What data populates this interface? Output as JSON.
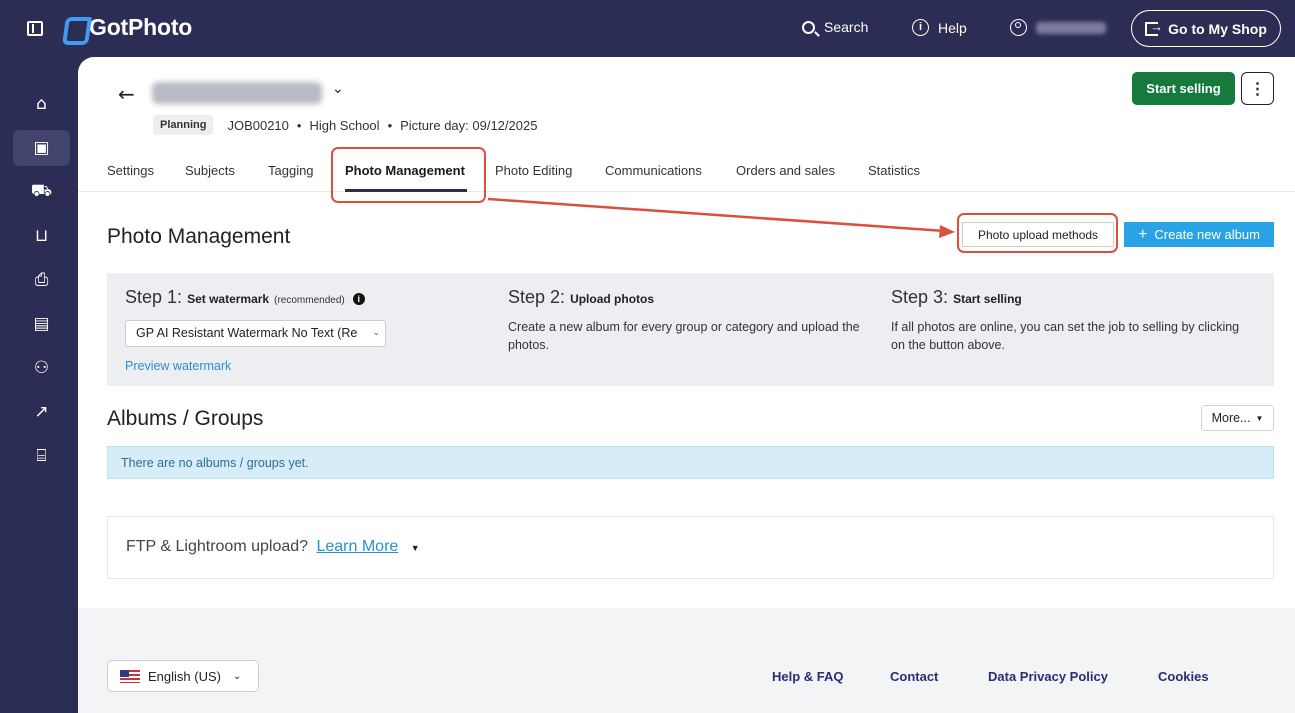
{
  "app": {
    "brand": "GotPhoto",
    "top_nav": {
      "search_label": "Search",
      "help_label": "Help",
      "shop_button": "Go to My Shop"
    },
    "sidebar": [
      {
        "icon": "home-icon",
        "glyph": "⌂"
      },
      {
        "icon": "photo-icon",
        "glyph": "▣",
        "active": true
      },
      {
        "icon": "cart-icon",
        "glyph": "🛒"
      },
      {
        "icon": "basket-icon",
        "glyph": "⊔"
      },
      {
        "icon": "printer-icon",
        "glyph": "⎙"
      },
      {
        "icon": "message-icon",
        "glyph": "▤"
      },
      {
        "icon": "user-icon",
        "glyph": "⚇"
      },
      {
        "icon": "analytics-icon",
        "glyph": "📈"
      },
      {
        "icon": "store-icon",
        "glyph": "⌸"
      }
    ]
  },
  "job": {
    "status_badge": "Planning",
    "job_id": "JOB00210",
    "school_type": "High School",
    "picture_day": "Picture day: 09/12/2025",
    "start_selling": "Start selling",
    "more_actions": "⋮"
  },
  "tabs": [
    {
      "label": "Settings"
    },
    {
      "label": "Subjects"
    },
    {
      "label": "Tagging"
    },
    {
      "label": "Photo Management",
      "active": true
    },
    {
      "label": "Photo Editing"
    },
    {
      "label": "Communications"
    },
    {
      "label": "Orders and sales"
    },
    {
      "label": "Statistics"
    }
  ],
  "photo_management": {
    "title": "Photo Management",
    "upload_methods_button": "Photo upload methods",
    "create_album_button": "Create new album",
    "steps": [
      {
        "prefix": "Step 1:",
        "name": "Set watermark",
        "note": "(recommended)"
      },
      {
        "prefix": "Step 2:",
        "name": "Upload photos",
        "description": "Create a new album for every group or category and upload the photos."
      },
      {
        "prefix": "Step 3:",
        "name": "Start selling",
        "description": "If all photos are online, you can set the job to selling by clicking on the button above."
      }
    ],
    "watermark_select_value": "GP AI Resistant Watermark No Text (Re",
    "preview_watermark": "Preview watermark"
  },
  "albums": {
    "title": "Albums / Groups",
    "more_button": "More...",
    "empty_message": "There are no albums / groups yet."
  },
  "ftp": {
    "text": "FTP & Lightroom upload?",
    "link": "Learn More"
  },
  "footer": {
    "language": "English (US)",
    "links": [
      "Help & FAQ",
      "Contact",
      "Data Privacy Policy",
      "Cookies"
    ]
  },
  "colors": {
    "nav_bg": "#2b2d55",
    "brand_blue": "#3f9cf2",
    "start_selling_green": "#157a3c",
    "create_button_blue": "#2aa3e6",
    "annotation_red": "#d9503c"
  }
}
